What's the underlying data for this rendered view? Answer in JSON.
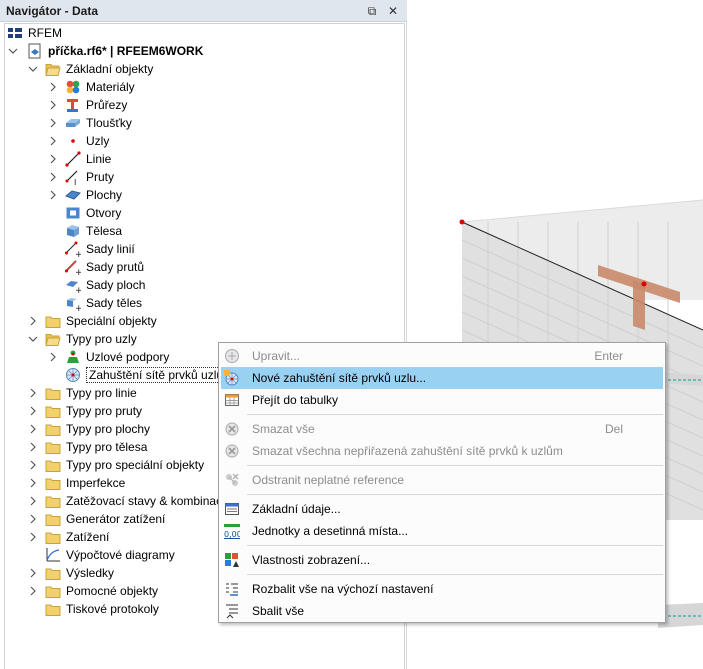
{
  "navigator": {
    "title": "Navigátor - Data",
    "btn_float": "⧉",
    "btn_close": "✕",
    "tree": [
      {
        "label": "RFEM",
        "icon": "rfem-flag-icon",
        "level": 0,
        "expander": "none"
      },
      {
        "label": "příčka.rf6* | RFEEM6WORK",
        "icon": "model-file-icon",
        "level": 0,
        "expander": "open",
        "bold": true
      },
      {
        "label": "Základní objekty",
        "icon": "folder-open-icon",
        "level": 1,
        "expander": "open"
      },
      {
        "label": "Materiály",
        "icon": "materials-icon",
        "level": 2,
        "expander": "closed"
      },
      {
        "label": "Průřezy",
        "icon": "cross-sections-icon",
        "level": 2,
        "expander": "closed"
      },
      {
        "label": "Tloušťky",
        "icon": "thicknesses-icon",
        "level": 2,
        "expander": "closed"
      },
      {
        "label": "Uzly",
        "icon": "nodes-icon",
        "level": 2,
        "expander": "closed"
      },
      {
        "label": "Linie",
        "icon": "lines-icon",
        "level": 2,
        "expander": "closed"
      },
      {
        "label": "Pruty",
        "icon": "members-icon",
        "level": 2,
        "expander": "closed"
      },
      {
        "label": "Plochy",
        "icon": "surfaces-icon",
        "level": 2,
        "expander": "closed"
      },
      {
        "label": "Otvory",
        "icon": "openings-icon",
        "level": 2,
        "expander": "none"
      },
      {
        "label": "Tělesa",
        "icon": "solids-icon",
        "level": 2,
        "expander": "none"
      },
      {
        "label": "Sady linií",
        "icon": "line-sets-icon",
        "level": 2,
        "expander": "none"
      },
      {
        "label": "Sady prutů",
        "icon": "member-sets-icon",
        "level": 2,
        "expander": "none"
      },
      {
        "label": "Sady ploch",
        "icon": "surface-sets-icon",
        "level": 2,
        "expander": "none"
      },
      {
        "label": "Sady těles",
        "icon": "solid-sets-icon",
        "level": 2,
        "expander": "none"
      },
      {
        "label": "Speciální objekty",
        "icon": "folder-icon",
        "level": 1,
        "expander": "closed"
      },
      {
        "label": "Typy pro uzly",
        "icon": "folder-open-icon",
        "level": 1,
        "expander": "open"
      },
      {
        "label": "Uzlové podpory",
        "icon": "nodal-support-icon",
        "level": 2,
        "expander": "closed"
      },
      {
        "label": "Zahuštění sítě prvků uzlů",
        "icon": "mesh-refinement-icon",
        "level": 2,
        "expander": "none",
        "selected": true
      },
      {
        "label": "Typy pro linie",
        "icon": "folder-icon",
        "level": 1,
        "expander": "closed"
      },
      {
        "label": "Typy pro pruty",
        "icon": "folder-icon",
        "level": 1,
        "expander": "closed"
      },
      {
        "label": "Typy pro plochy",
        "icon": "folder-icon",
        "level": 1,
        "expander": "closed"
      },
      {
        "label": "Typy pro tělesa",
        "icon": "folder-icon",
        "level": 1,
        "expander": "closed"
      },
      {
        "label": "Typy pro speciální objekty",
        "icon": "folder-icon",
        "level": 1,
        "expander": "closed"
      },
      {
        "label": "Imperfekce",
        "icon": "folder-icon",
        "level": 1,
        "expander": "closed"
      },
      {
        "label": "Zatěžovací stavy & kombinace",
        "icon": "folder-icon",
        "level": 1,
        "expander": "closed"
      },
      {
        "label": "Generátor zatížení",
        "icon": "folder-icon",
        "level": 1,
        "expander": "closed"
      },
      {
        "label": "Zatížení",
        "icon": "folder-icon",
        "level": 1,
        "expander": "closed"
      },
      {
        "label": "Výpočtové diagramy",
        "icon": "calc-diagram-icon",
        "level": 1,
        "expander": "none"
      },
      {
        "label": "Výsledky",
        "icon": "folder-icon",
        "level": 1,
        "expander": "closed"
      },
      {
        "label": "Pomocné objekty",
        "icon": "folder-icon",
        "level": 1,
        "expander": "closed"
      },
      {
        "label": "Tiskové protokoly",
        "icon": "folder-icon",
        "level": 1,
        "expander": "none"
      }
    ]
  },
  "context_menu": {
    "items": [
      {
        "type": "item",
        "label": "Upravit...",
        "shortcut": "Enter",
        "icon": "edit-icon",
        "disabled": true
      },
      {
        "type": "item",
        "label": "Nové zahuštění sítě prvků uzlu...",
        "shortcut": "",
        "icon": "new-mesh-refinement-icon",
        "highlighted": true
      },
      {
        "type": "item",
        "label": "Přejít do tabulky",
        "shortcut": "",
        "icon": "go-to-table-icon"
      },
      {
        "type": "sep"
      },
      {
        "type": "item",
        "label": "Smazat vše",
        "shortcut": "Del",
        "icon": "delete-all-icon",
        "disabled": true
      },
      {
        "type": "item",
        "label": "Smazat všechna nepřiřazená zahuštění sítě prvků k uzlům",
        "shortcut": "",
        "icon": "delete-unassigned-icon",
        "disabled": true
      },
      {
        "type": "sep"
      },
      {
        "type": "item",
        "label": "Odstranit neplatné reference",
        "shortcut": "",
        "icon": "remove-invalid-refs-icon",
        "disabled": true
      },
      {
        "type": "sep"
      },
      {
        "type": "item",
        "label": "Základní údaje...",
        "shortcut": "",
        "icon": "base-data-icon"
      },
      {
        "type": "item",
        "label": "Jednotky a desetinná místa...",
        "shortcut": "",
        "icon": "units-icon",
        "icon_text": "0,00"
      },
      {
        "type": "sep"
      },
      {
        "type": "item",
        "label": "Vlastnosti zobrazení...",
        "shortcut": "",
        "icon": "display-properties-icon"
      },
      {
        "type": "sep"
      },
      {
        "type": "item",
        "label": "Rozbalit vše na výchozí nastavení",
        "shortcut": "",
        "icon": "expand-default-icon"
      },
      {
        "type": "item",
        "label": "Sbalit vše",
        "shortcut": "",
        "icon": "collapse-all-icon"
      }
    ]
  },
  "colors": {
    "highlight": "#99d1f3",
    "folder": "#f2d06b",
    "viewport_wall": "#e3e3e3",
    "member": "#c98a6a",
    "node": "#e00000"
  }
}
